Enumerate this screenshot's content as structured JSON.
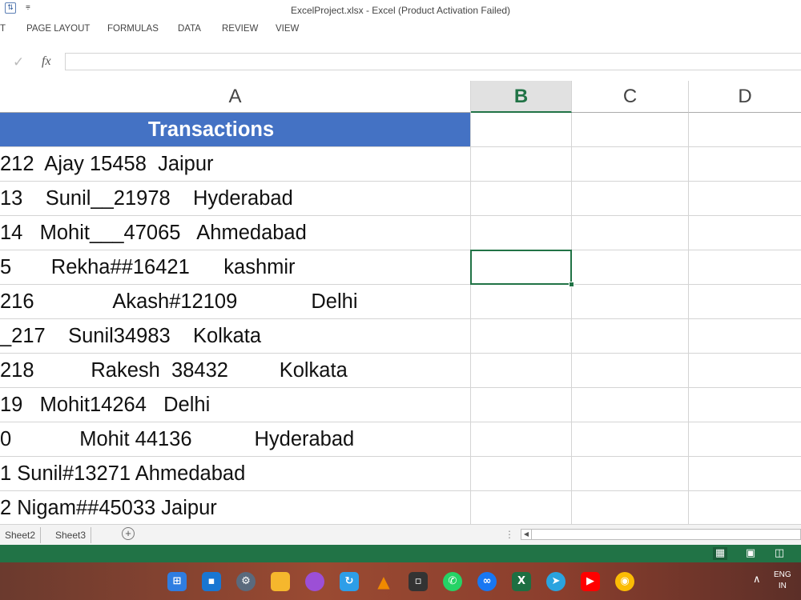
{
  "window": {
    "title": "ExcelProject.xlsx - Excel (Product Activation Failed)"
  },
  "ribbon": {
    "tabs": [
      "T",
      "PAGE LAYOUT",
      "FORMULAS",
      "DATA",
      "REVIEW",
      "VIEW"
    ]
  },
  "formula_bar": {
    "fx_label": "fx",
    "value": ""
  },
  "columns": [
    "A",
    "B",
    "C",
    "D"
  ],
  "selected_column": "B",
  "sheet": {
    "header": "Transactions",
    "rows": [
      "212  Ajay 15458  Jaipur",
      "13    Sunil__21978    Hyderabad",
      "14   Mohit___47065   Ahmedabad",
      "5       Rekha##16421      kashmir",
      "216              Akash#12109             Delhi",
      "_217    Sunil34983    Kolkata",
      "218          Rakesh  38432         Kolkata",
      "19   Mohit14264   Delhi",
      "0            Mohit 44136           Hyderabad",
      "1 Sunil#13271 Ahmedabad",
      "2 Nigam##45033 Jaipur"
    ]
  },
  "sheet_tabs": [
    "Sheet2",
    "Sheet3"
  ],
  "add_sheet_label": "+",
  "status_bar": {
    "view_icons": [
      "normal-view-icon",
      "page-layout-view-icon",
      "page-break-view-icon"
    ]
  },
  "taskbar": {
    "icons": [
      "windows-start-icon",
      "store-icon",
      "settings-icon",
      "file-explorer-icon",
      "app-icon",
      "sync-icon",
      "vlc-icon",
      "terminal-icon",
      "whatsapp-icon",
      "app-icon-2",
      "excel-icon",
      "telegram-icon",
      "youtube-icon",
      "chrome-icon"
    ],
    "language": "ENG",
    "region": "IN"
  },
  "colors": {
    "accent": "#217346",
    "header_fill": "#4472c4",
    "grid": "#d4d4d4"
  }
}
